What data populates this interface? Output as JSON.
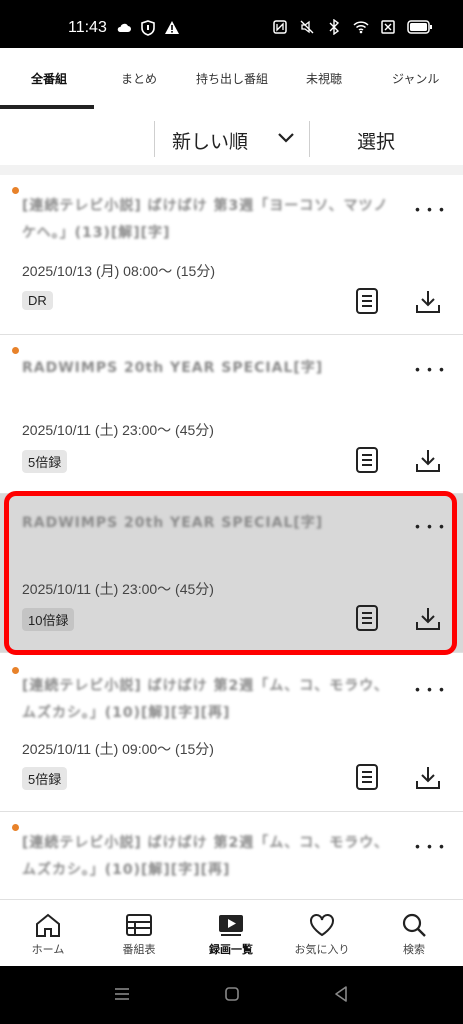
{
  "status_bar": {
    "time": "11:43",
    "left_icons": [
      "weather-cloud-icon",
      "shield-icon",
      "warning-icon"
    ],
    "right_icons": [
      "nfc-icon",
      "mute-icon",
      "bluetooth-icon",
      "wifi-icon",
      "sim-off-icon",
      "battery-icon"
    ]
  },
  "tabs": [
    {
      "label": "全番組",
      "active": true
    },
    {
      "label": "まとめ",
      "active": false
    },
    {
      "label": "持ち出し番組",
      "active": false
    },
    {
      "label": "未視聴",
      "active": false
    },
    {
      "label": "ジャンル",
      "active": false
    }
  ],
  "sort": {
    "current": "新しい順",
    "select_label": "選択"
  },
  "recordings": [
    {
      "title": "[連続テレビ小説] ばけばけ 第3週「ヨーコソ、マツノケヘ。」(13)[解][字]",
      "datetime": "2025/10/13 (月) 08:00～ (15分)",
      "badge": "DR",
      "selected": false
    },
    {
      "title": "RADWIMPS 20th YEAR SPECIAL[字]",
      "datetime": "2025/10/11 (土) 23:00～ (45分)",
      "badge": "5倍録",
      "selected": false
    },
    {
      "title": "RADWIMPS 20th YEAR SPECIAL[字]",
      "datetime": "2025/10/11 (土) 23:00～ (45分)",
      "badge": "10倍録",
      "selected": true
    },
    {
      "title": "[連続テレビ小説] ばけばけ 第2週「ム、コ、モラウ、ムズカシ。」(10)[解][字][再]",
      "datetime": "2025/10/11 (土) 09:00～ (15分)",
      "badge": "5倍録",
      "selected": false
    },
    {
      "title": "[連続テレビ小説] ばけばけ 第2週「ム、コ、モラウ、ムズカシ。」(10)[解][字][再]",
      "datetime": "",
      "badge": "",
      "selected": false
    }
  ],
  "more_label": "･･･",
  "bottom_nav": [
    {
      "label": "ホーム",
      "icon": "home-icon",
      "active": false
    },
    {
      "label": "番組表",
      "icon": "program-guide-icon",
      "active": false
    },
    {
      "label": "録画一覧",
      "icon": "recordings-icon",
      "active": true
    },
    {
      "label": "お気に入り",
      "icon": "heart-icon",
      "active": false
    },
    {
      "label": "検索",
      "icon": "search-icon",
      "active": false
    }
  ],
  "colors": {
    "new_dot": "#e8822a",
    "highlight": "#ff0000",
    "selected_bg": "#d8d8d8"
  }
}
